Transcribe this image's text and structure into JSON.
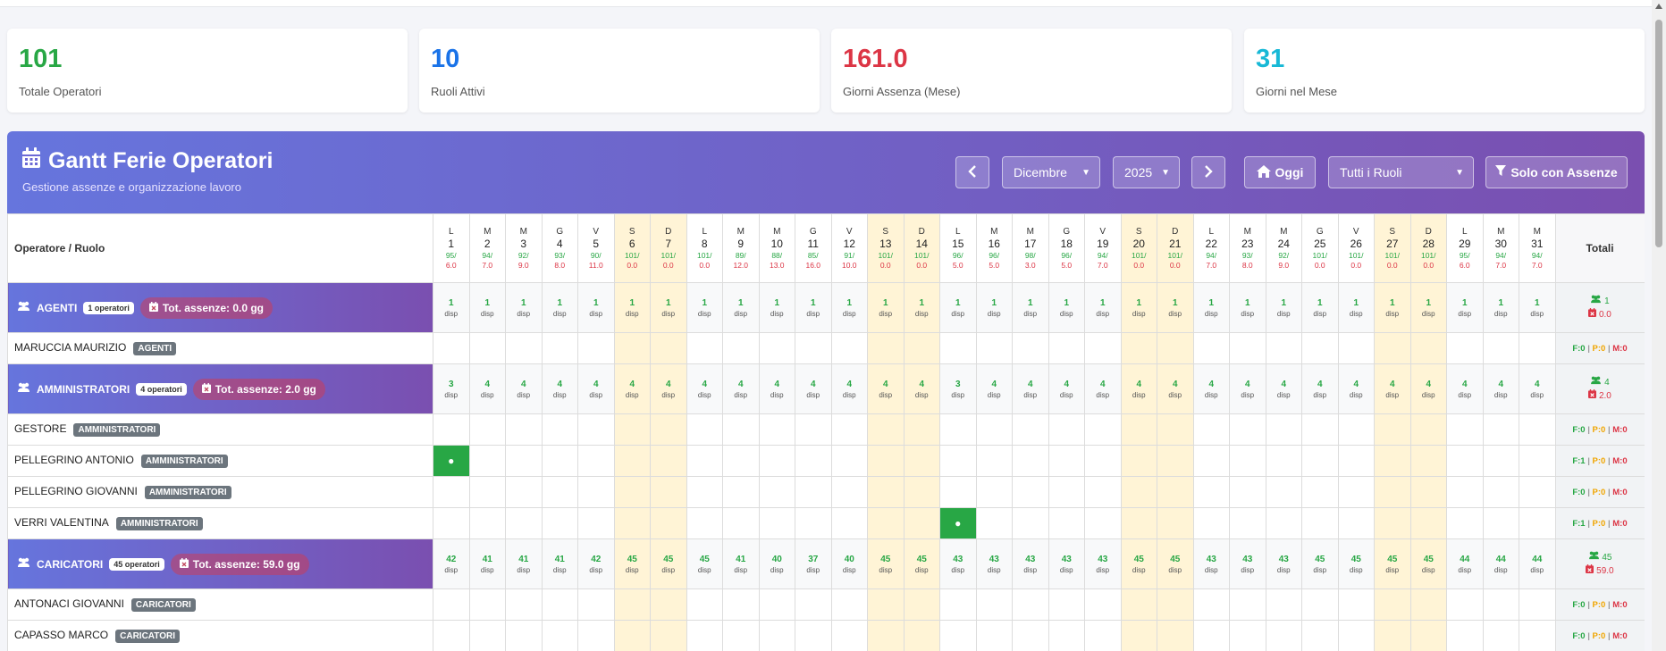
{
  "stats": [
    {
      "value": "101",
      "label": "Totale Operatori",
      "color": "#28a745"
    },
    {
      "value": "10",
      "label": "Ruoli Attivi",
      "color": "#1a73e8"
    },
    {
      "value": "161.0",
      "label": "Giorni Assenza (Mese)",
      "color": "#dc3545"
    },
    {
      "value": "31",
      "label": "Giorni nel Mese",
      "color": "#17b8d6"
    }
  ],
  "header": {
    "title": "Gantt Ferie Operatori",
    "subtitle": "Gestione assenze e organizzazione lavoro",
    "month": "Dicembre",
    "year": "2025",
    "today_label": "Oggi",
    "role_filter": "Tutti i Ruoli",
    "absences_only_label": "Solo con Assenze",
    "prev_icon": "chevron-left-icon",
    "next_icon": "chevron-right-icon"
  },
  "table": {
    "operator_header": "Operatore / Ruolo",
    "totals_header": "Totali",
    "days": [
      {
        "w": "L",
        "n": "1",
        "a": "95/",
        "b": "6.0",
        "we": false
      },
      {
        "w": "M",
        "n": "2",
        "a": "94/",
        "b": "7.0",
        "we": false
      },
      {
        "w": "M",
        "n": "3",
        "a": "92/",
        "b": "9.0",
        "we": false
      },
      {
        "w": "G",
        "n": "4",
        "a": "93/",
        "b": "8.0",
        "we": false
      },
      {
        "w": "V",
        "n": "5",
        "a": "90/",
        "b": "11.0",
        "we": false
      },
      {
        "w": "S",
        "n": "6",
        "a": "101/",
        "b": "0.0",
        "we": true
      },
      {
        "w": "D",
        "n": "7",
        "a": "101/",
        "b": "0.0",
        "we": true
      },
      {
        "w": "L",
        "n": "8",
        "a": "101/",
        "b": "0.0",
        "we": false
      },
      {
        "w": "M",
        "n": "9",
        "a": "89/",
        "b": "12.0",
        "we": false
      },
      {
        "w": "M",
        "n": "10",
        "a": "88/",
        "b": "13.0",
        "we": false
      },
      {
        "w": "G",
        "n": "11",
        "a": "85/",
        "b": "16.0",
        "we": false
      },
      {
        "w": "V",
        "n": "12",
        "a": "91/",
        "b": "10.0",
        "we": false
      },
      {
        "w": "S",
        "n": "13",
        "a": "101/",
        "b": "0.0",
        "we": true
      },
      {
        "w": "D",
        "n": "14",
        "a": "101/",
        "b": "0.0",
        "we": true
      },
      {
        "w": "L",
        "n": "15",
        "a": "96/",
        "b": "5.0",
        "we": false
      },
      {
        "w": "M",
        "n": "16",
        "a": "96/",
        "b": "5.0",
        "we": false
      },
      {
        "w": "M",
        "n": "17",
        "a": "98/",
        "b": "3.0",
        "we": false
      },
      {
        "w": "G",
        "n": "18",
        "a": "96/",
        "b": "5.0",
        "we": false
      },
      {
        "w": "V",
        "n": "19",
        "a": "94/",
        "b": "7.0",
        "we": false
      },
      {
        "w": "S",
        "n": "20",
        "a": "101/",
        "b": "0.0",
        "we": true
      },
      {
        "w": "D",
        "n": "21",
        "a": "101/",
        "b": "0.0",
        "we": true
      },
      {
        "w": "L",
        "n": "22",
        "a": "94/",
        "b": "7.0",
        "we": false
      },
      {
        "w": "M",
        "n": "23",
        "a": "93/",
        "b": "8.0",
        "we": false
      },
      {
        "w": "M",
        "n": "24",
        "a": "92/",
        "b": "9.0",
        "we": false
      },
      {
        "w": "G",
        "n": "25",
        "a": "101/",
        "b": "0.0",
        "we": false
      },
      {
        "w": "V",
        "n": "26",
        "a": "101/",
        "b": "0.0",
        "we": false
      },
      {
        "w": "S",
        "n": "27",
        "a": "101/",
        "b": "0.0",
        "we": true
      },
      {
        "w": "D",
        "n": "28",
        "a": "101/",
        "b": "0.0",
        "we": true
      },
      {
        "w": "L",
        "n": "29",
        "a": "95/",
        "b": "6.0",
        "we": false
      },
      {
        "w": "M",
        "n": "30",
        "a": "94/",
        "b": "7.0",
        "we": false
      },
      {
        "w": "M",
        "n": "31",
        "a": "94/",
        "b": "7.0",
        "we": false
      }
    ],
    "avail_label": "disp",
    "groups": [
      {
        "name": "AGENTI",
        "count_badge": "1 operatori",
        "absence_total": "Tot. assenze: 0.0 gg",
        "tot_people": "1",
        "tot_days": "0.0",
        "counts": [
          "1",
          "1",
          "1",
          "1",
          "1",
          "1",
          "1",
          "1",
          "1",
          "1",
          "1",
          "1",
          "1",
          "1",
          "1",
          "1",
          "1",
          "1",
          "1",
          "1",
          "1",
          "1",
          "1",
          "1",
          "1",
          "1",
          "1",
          "1",
          "1",
          "1",
          "1"
        ],
        "operators": [
          {
            "name": "MARUCCIA MAURIZIO",
            "role": "AGENTI",
            "f": "F:0",
            "p": "P:0",
            "m": "M:0",
            "absent_day": 0
          }
        ]
      },
      {
        "name": "AMMINISTRATORI",
        "count_badge": "4 operatori",
        "absence_total": "Tot. assenze: 2.0 gg",
        "tot_people": "4",
        "tot_days": "2.0",
        "counts": [
          "3",
          "4",
          "4",
          "4",
          "4",
          "4",
          "4",
          "4",
          "4",
          "4",
          "4",
          "4",
          "4",
          "4",
          "3",
          "4",
          "4",
          "4",
          "4",
          "4",
          "4",
          "4",
          "4",
          "4",
          "4",
          "4",
          "4",
          "4",
          "4",
          "4",
          "4"
        ],
        "operators": [
          {
            "name": "GESTORE",
            "role": "AMMINISTRATORI",
            "f": "F:0",
            "p": "P:0",
            "m": "M:0",
            "absent_day": 0
          },
          {
            "name": "PELLEGRINO ANTONIO",
            "role": "AMMINISTRATORI",
            "f": "F:1",
            "p": "P:0",
            "m": "M:0",
            "absent_day": 1
          },
          {
            "name": "PELLEGRINO GIOVANNI",
            "role": "AMMINISTRATORI",
            "f": "F:0",
            "p": "P:0",
            "m": "M:0",
            "absent_day": 0
          },
          {
            "name": "VERRI VALENTINA",
            "role": "AMMINISTRATORI",
            "f": "F:1",
            "p": "P:0",
            "m": "M:0",
            "absent_day": 15
          }
        ]
      },
      {
        "name": "CARICATORI",
        "count_badge": "45 operatori",
        "absence_total": "Tot. assenze: 59.0 gg",
        "tot_people": "45",
        "tot_days": "59.0",
        "counts": [
          "42",
          "41",
          "41",
          "41",
          "42",
          "45",
          "45",
          "45",
          "41",
          "40",
          "37",
          "40",
          "45",
          "45",
          "43",
          "43",
          "43",
          "43",
          "43",
          "45",
          "45",
          "43",
          "43",
          "43",
          "45",
          "45",
          "45",
          "45",
          "44",
          "44",
          "44"
        ],
        "operators": [
          {
            "name": "ANTONACI GIOVANNI",
            "role": "CARICATORI",
            "f": "F:0",
            "p": "P:0",
            "m": "M:0",
            "absent_day": 0
          },
          {
            "name": "CAPASSO MARCO",
            "role": "CARICATORI",
            "f": "F:0",
            "p": "P:0",
            "m": "M:0",
            "absent_day": 0
          }
        ]
      }
    ],
    "absence_mark": "●"
  }
}
